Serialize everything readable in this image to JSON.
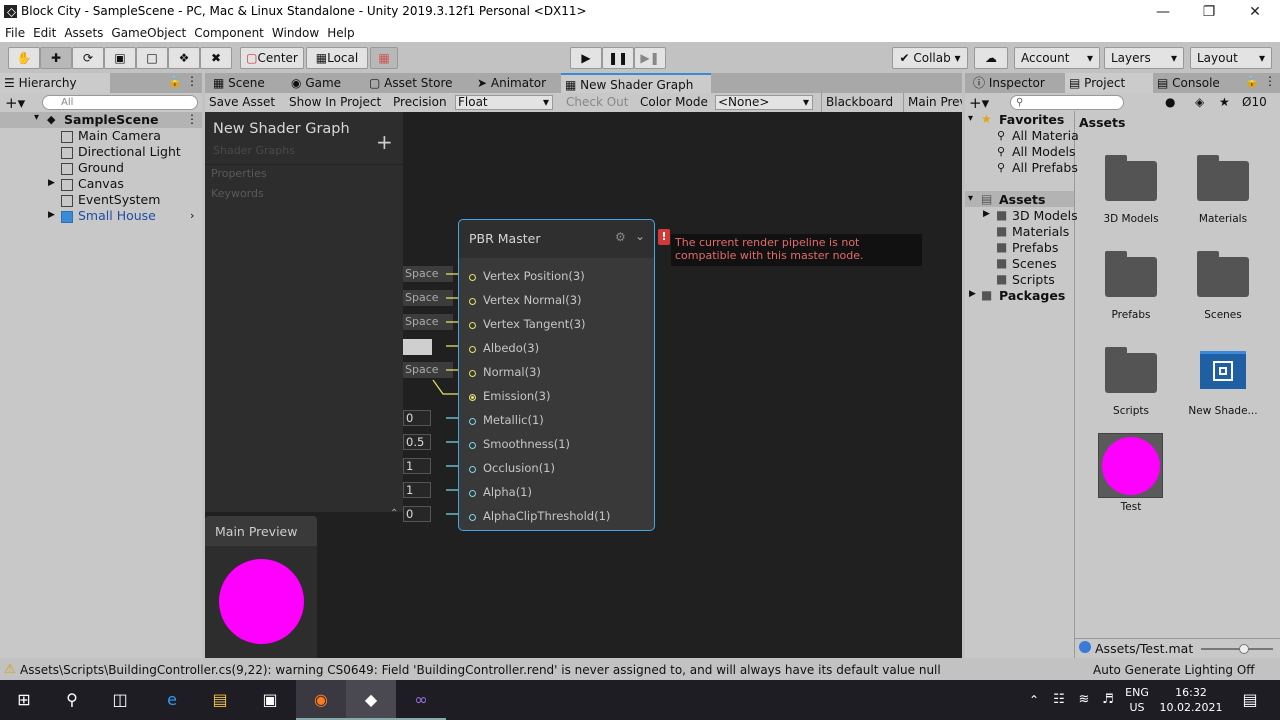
{
  "window": {
    "title": "Block City - SampleScene - PC, Mac & Linux Standalone - Unity 2019.3.12f1 Personal <DX11>"
  },
  "menu": [
    "File",
    "Edit",
    "Assets",
    "GameObject",
    "Component",
    "Window",
    "Help"
  ],
  "toolbar": {
    "center_label": "Center",
    "local_label": "Local",
    "collab_label": "Collab",
    "account_label": "Account",
    "layers_label": "Layers",
    "layout_label": "Layout"
  },
  "hierarchy": {
    "tab_label": "Hierarchy",
    "search_placeholder": "All",
    "scene_name": "SampleScene",
    "items": [
      "Main Camera",
      "Directional Light",
      "Ground",
      "Canvas",
      "EventSystem",
      "Small House"
    ]
  },
  "center_tabs": [
    "Scene",
    "Game",
    "Asset Store",
    "Animator",
    "New Shader Graph"
  ],
  "shader_toolbar": {
    "save_asset": "Save Asset",
    "show_in_project": "Show In Project",
    "precision_label": "Precision",
    "precision_value": "Float",
    "check_out": "Check Out",
    "color_mode_label": "Color Mode",
    "color_mode_value": "<None>",
    "blackboard": "Blackboard",
    "main_preview": "Main Prev"
  },
  "blackboard": {
    "title": "New Shader Graph",
    "subtitle": "Shader Graphs",
    "properties": "Properties",
    "keywords": "Keywords"
  },
  "master_node": {
    "title": "PBR Master",
    "ports": [
      "Vertex Position(3)",
      "Vertex Normal(3)",
      "Vertex Tangent(3)",
      "Albedo(3)",
      "Normal(3)",
      "Emission(3)",
      "Metallic(1)",
      "Smoothness(1)",
      "Occlusion(1)",
      "Alpha(1)",
      "AlphaClipThreshold(1)"
    ],
    "inputs": [
      "Space",
      "Space",
      "Space",
      "",
      "Space"
    ],
    "values": [
      "0",
      "0.5",
      "1",
      "1",
      "0"
    ],
    "error_line1": "The current render pipeline is not",
    "error_line2": "compatible with this master node."
  },
  "main_preview": {
    "title": "Main Preview",
    "color": "#ff00ff"
  },
  "right_tabs": [
    "Inspector",
    "Project",
    "Console"
  ],
  "project": {
    "favorites": "Favorites",
    "fav_items": [
      "All Materia",
      "All Models",
      "All Prefabs"
    ],
    "assets": "Assets",
    "asset_folders": [
      "3D Models",
      "Materials",
      "Prefabs",
      "Scenes",
      "Scripts"
    ],
    "packages": "Packages",
    "assets_header": "Assets",
    "grid_items": [
      "3D Models",
      "Materials",
      "Prefabs",
      "Scenes",
      "Scripts",
      "New Shade...",
      "Test"
    ],
    "hidden_count": "10",
    "footer_path": "Assets/Test.mat"
  },
  "status": {
    "warning": "Assets\\Scripts\\BuildingController.cs(9,22): warning CS0649: Field 'BuildingController.rend' is never assigned to, and will always have its default value null",
    "lighting": "Auto Generate Lighting Off"
  },
  "taskbar": {
    "lang1": "ENG",
    "lang2": "US",
    "time": "16:32",
    "date": "10.02.2021"
  }
}
